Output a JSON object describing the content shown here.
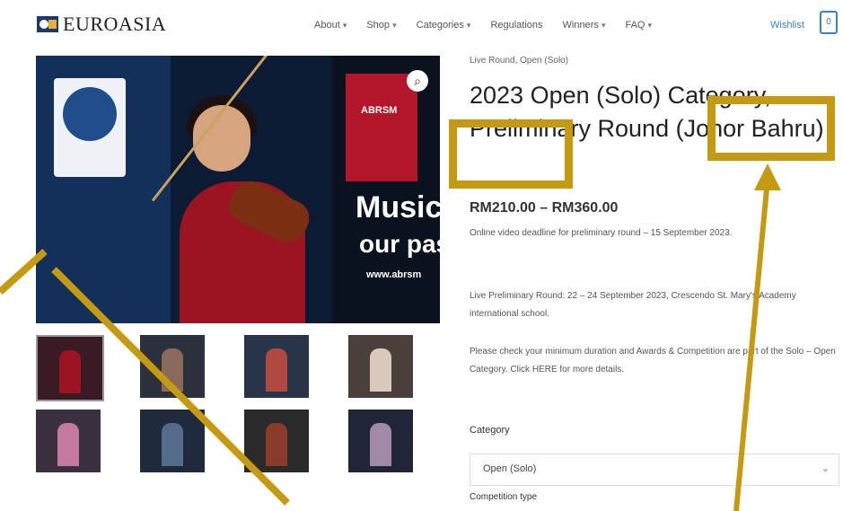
{
  "header": {
    "logo_text": "EUROASIA",
    "nav": [
      "About",
      "Shop",
      "Categories",
      "Regulations",
      "Winners",
      "FAQ"
    ],
    "wishlist": "Wishlist",
    "cart_count": "0"
  },
  "product": {
    "breadcrumb": "Live Round, Open (Solo)",
    "title": "2023 Open (Solo) Category, Preliminary Round (Johor Bahru)",
    "price": "RM210.00 – RM360.00",
    "desc1": "Online video deadline for preliminary round – 15 September 2023.",
    "desc2": "Live Preliminary Round: 22 – 24 September 2023, Crescendo St. Mary's Academy international school.",
    "desc3": "Please check your minimum duration and Awards & Competition are part of the Solo – Open Category. Click HERE for more details.",
    "category_label": "Category",
    "category_value": "Open (Solo)",
    "competition_label": "Competition type"
  },
  "main_image": {
    "banner_text1": "ABRSM",
    "banner_text2": "Music",
    "banner_text3": "our pas",
    "banner_text4": "www.abrsm"
  },
  "colors": {
    "highlight": "#c49a12",
    "link": "#3b82c4"
  },
  "icons": {
    "zoom": "search-icon",
    "cart": "cart-icon",
    "select": "chevron-down-icon"
  }
}
